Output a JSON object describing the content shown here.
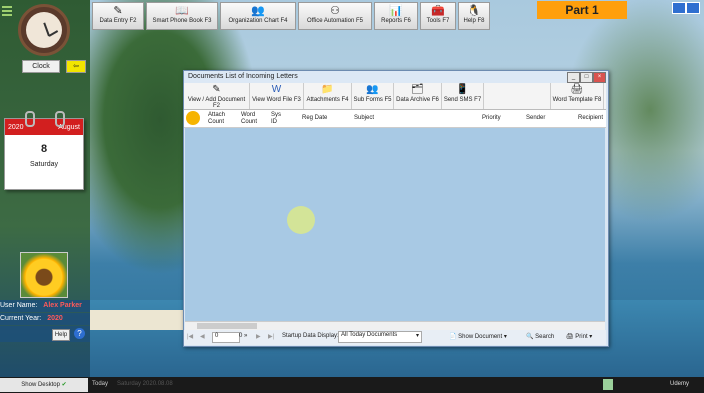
{
  "toolbar": {
    "items": [
      {
        "label": "Data Entry F2",
        "icon": "pen"
      },
      {
        "label": "Smart Phone Book F3",
        "icon": "book"
      },
      {
        "label": "Organization Chart F4",
        "icon": "people"
      },
      {
        "label": "Office Automation F5",
        "icon": "org"
      },
      {
        "label": "Reports F6",
        "icon": "chart"
      },
      {
        "label": "Tools F7",
        "icon": "tools"
      },
      {
        "label": "Help F8",
        "icon": "penguin"
      }
    ],
    "part_label": "Part 1"
  },
  "left": {
    "clock_button": "Clock",
    "arrow_button": "⇦",
    "calendar": {
      "year": "2020",
      "month": "August",
      "day": "8",
      "weekday": "Saturday"
    },
    "user_label": "User Name:",
    "user_value": "Alex Parker",
    "year_label": "Current Year:",
    "year_value": "2020",
    "help": "Help"
  },
  "window": {
    "title": "Documents List of Incoming Letters",
    "tools": [
      {
        "label": "View / Add Document F2",
        "icon": "pen"
      },
      {
        "label": "View Word File F3",
        "icon": "word"
      },
      {
        "label": "Attachments F4",
        "icon": "folder"
      },
      {
        "label": "Sub Forms F5",
        "icon": "people"
      },
      {
        "label": "Data Archive F6",
        "icon": "archive"
      },
      {
        "label": "Send SMS F7",
        "icon": "phone"
      },
      {
        "label": "Word Template F8",
        "icon": "printer"
      }
    ],
    "columns": [
      "Attach Count",
      "Word Count",
      "Sys ID",
      "Reg Date",
      "Subject",
      "Priority",
      "Sender",
      "Recipient"
    ],
    "footer": {
      "page_value": "0",
      "page_suffix": "0 »",
      "startup_label": "Startup Data Display:",
      "startup_value": "All Today Documents",
      "show_document": "Show Document",
      "search": "Search",
      "print": "Print"
    }
  },
  "taskbar": {
    "show_desktop": "Show Desktop",
    "today": "Today",
    "today_value": "Saturday 2020.08.08",
    "brand": "Udemy"
  }
}
